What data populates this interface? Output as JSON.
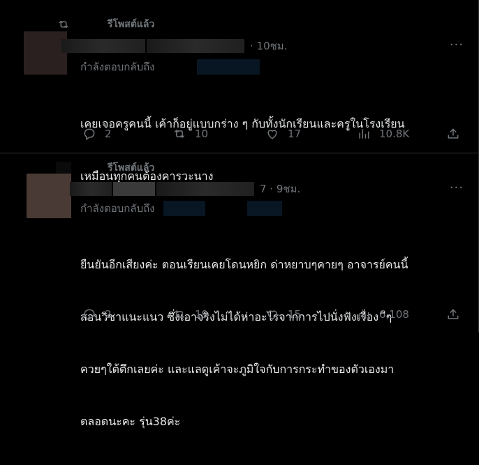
{
  "tweets": [
    {
      "retweet_label": "รีโพสต์แล้ว",
      "time": "· 10ชม.",
      "more": "···",
      "reply_label": "กำลังตอบกลับถึง",
      "text_lines": [
        "เคยเจอครูคนนี้ เค้าก็อยู่แบบกร่าง ๆ กับทั้งนักเรียนและครูในโรงเรียน",
        "เหมือนทุกคนต้องคารวะนาง"
      ],
      "replies": "2",
      "reposts": "10",
      "likes": "17",
      "views": "10.8K"
    },
    {
      "retweet_label": "รีโพสต์แล้ว",
      "time": "7 · 9ชม.",
      "more": "···",
      "reply_label": "กำลังตอบกลับถึง",
      "text_lines": [
        "ยืนยันอีกเสียงค่ะ ตอนเรียนเคยโดนหยิก ด่าหยาบๆคายๆ อาจารย์คนนี้",
        "สอนวิชาแนะแนว ซึ่งเอาจริงไม่ได้ห่าอะไรจากการไปนั่งฟังเรื่อง  ีๆ",
        "ควยๆใต้ตึกเลยค่ะ และแลดูเค้าจะภูมิใจกับการกระทำของตัวเองมา",
        "ตลอดนะคะ รุ่น38ค่ะ"
      ],
      "replies": "2",
      "reposts": "19",
      "likes": "15",
      "views": "6,108"
    }
  ]
}
